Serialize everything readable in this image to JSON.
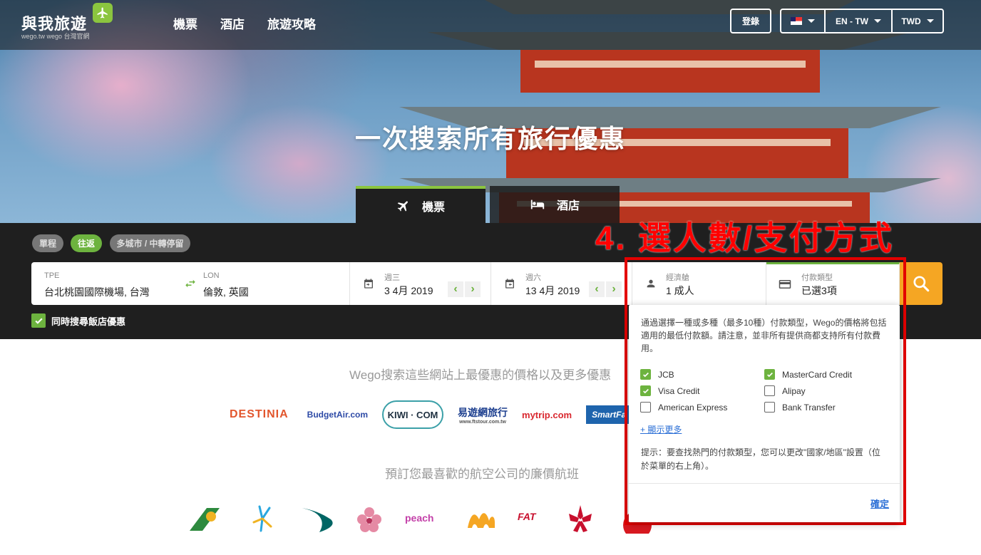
{
  "header": {
    "logo_text": "與我旅遊",
    "logo_sub": "wego.tw wego 台灣官網",
    "nav": [
      "機票",
      "酒店",
      "旅遊攻略"
    ],
    "login": "登錄",
    "language": "EN - TW",
    "currency": "TWD"
  },
  "hero": {
    "headline": "一次搜索所有旅行優惠",
    "tabs": {
      "flights": "機票",
      "hotels": "酒店"
    }
  },
  "trip_types": [
    "單程",
    "往返",
    "多城市 / 中轉停留"
  ],
  "trip_type_selected": "往返",
  "search": {
    "origin_code": "TPE",
    "origin_name": "台北桃園國際機場, 台灣",
    "dest_code": "LON",
    "dest_name": "倫敦, 英國",
    "depart_day": "週三",
    "depart_date": "3 4月 2019",
    "return_day": "週六",
    "return_date": "13 4月 2019",
    "cabin": "經濟艙",
    "passengers": "1 成人",
    "payment_label": "付款類型",
    "payment_value": "已選3項"
  },
  "hotel_checkbox": "同時搜尋飯店優惠",
  "partners_title": "Wego搜索這些網站上最優惠的價格以及更多優惠",
  "partners": [
    "DESTINIA",
    "BudgetAir.com",
    "KIWI · COM",
    "易遊網旅行",
    "www.ftstour.com.tw",
    "mytrip.com",
    "SmartFa"
  ],
  "airlines_title": "預訂您最喜歡的航空公司的廉價航班",
  "airlines_text": {
    "peach": "peach",
    "fat": "FAT"
  },
  "annotation": "4. 選人數/支付方式",
  "payment_dropdown": {
    "description": "通過選擇一種或多種（最多10種）付款類型，Wego的價格將包括適用的最低付款額。請注意，並非所有提供商都支持所有付款費用。",
    "options": [
      {
        "label": "JCB",
        "checked": true
      },
      {
        "label": "MasterCard Credit",
        "checked": true
      },
      {
        "label": "Visa Credit",
        "checked": true
      },
      {
        "label": "Alipay",
        "checked": false
      },
      {
        "label": "American Express",
        "checked": false
      },
      {
        "label": "Bank Transfer",
        "checked": false
      }
    ],
    "show_more": "+ 顯示更多",
    "tip": "提示：要查找熱門的付款類型，您可以更改\"國家/地區\"設置（位於菜單的右上角）。",
    "confirm": "確定"
  },
  "colors": {
    "brand_green": "#6db33f",
    "search_orange": "#f5a623",
    "link_blue": "#2b6fd6",
    "annotation_red": "#e30000"
  }
}
